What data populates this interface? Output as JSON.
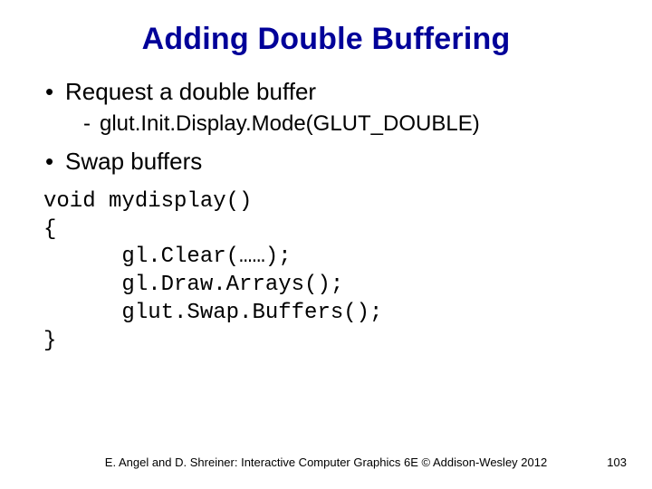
{
  "title": "Adding Double Buffering",
  "bullets": {
    "b1": "Request a double buffer",
    "b1a": "glut.Init.Display.Mode(GLUT_DOUBLE)",
    "b2": "Swap buffers"
  },
  "code": {
    "l1": "void mydisplay()",
    "l2": "{",
    "l3": "      gl.Clear(……);",
    "l4": "      gl.Draw.Arrays();",
    "l5": "      glut.Swap.Buffers();",
    "l6": "}"
  },
  "footer": {
    "credit": "E. Angel and D. Shreiner: Interactive Computer Graphics 6E © Addison-Wesley 2012",
    "page": "103"
  }
}
